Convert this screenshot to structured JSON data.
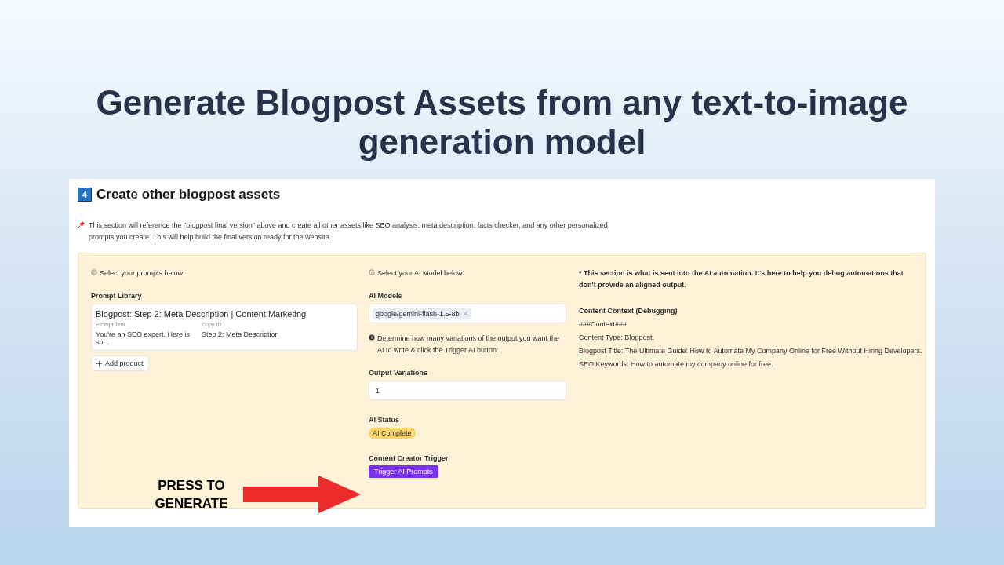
{
  "slide": {
    "title": "Generate Blogpost Assets from any text-to-image generation model"
  },
  "section": {
    "number": "4",
    "title": "Create other blogpost assets",
    "intro": "This section will reference the \"blogpost final version\" above and create all other assets like SEO analysis, meta description, facts checker, and any other personalized prompts you create. This will help build the final version ready for the website."
  },
  "prompts_column": {
    "hint": "Select your prompts below:",
    "label": "Prompt Library",
    "card": {
      "title": "Blogpost: Step 2: Meta Description | Content Marketing",
      "fields": [
        {
          "label": "Prompt Text",
          "value": "You're an SEO expert. Here is so..."
        },
        {
          "label": "Copy ID",
          "value": "Step 2: Meta Description"
        }
      ]
    },
    "add_button": "Add product"
  },
  "model_column": {
    "hint": "Select your AI Model below:",
    "models_label": "AI Models",
    "selected_models": [
      "google/gemini-flash-1.5-8b"
    ],
    "variations_hint": "Determine how many variations of the output you want the AI to write & click the Trigger AI button:",
    "variations_label": "Output Variations",
    "variations_value": "1",
    "status_label": "AI Status",
    "status": "AI Complete",
    "trigger_label": "Content Creator Trigger",
    "trigger_button": "Trigger AI Prompts"
  },
  "debug_column": {
    "note": "* This section is what is sent into the AI automation. It's here to help you debug automations that don't provide an aligned output.",
    "label": "Content Context (Debugging)",
    "lines": [
      "###Context###",
      "Content Type: Blogpost.",
      "Blogpost Title: The Ultimate Guide: How to Automate My Company Online for Free Without Hiring Developers.",
      "SEO Keywords: How to automate my company online for free."
    ]
  },
  "callout": {
    "text": "PRESS TO GENERATE"
  }
}
